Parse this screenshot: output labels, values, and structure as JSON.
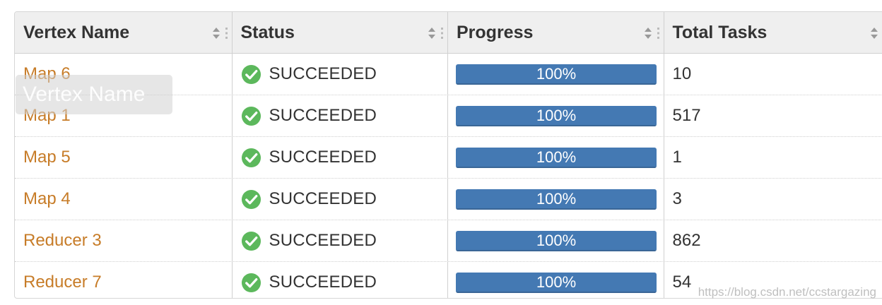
{
  "table": {
    "columns": [
      {
        "label": "Vertex Name"
      },
      {
        "label": "Status"
      },
      {
        "label": "Progress"
      },
      {
        "label": "Total Tasks"
      }
    ],
    "rows": [
      {
        "vertex": "Map 6",
        "status": "SUCCEEDED",
        "progress_text": "100%",
        "progress": 1.0,
        "total_tasks": "10"
      },
      {
        "vertex": "Map 1",
        "status": "SUCCEEDED",
        "progress_text": "100%",
        "progress": 1.0,
        "total_tasks": "517"
      },
      {
        "vertex": "Map 5",
        "status": "SUCCEEDED",
        "progress_text": "100%",
        "progress": 1.0,
        "total_tasks": "1"
      },
      {
        "vertex": "Map 4",
        "status": "SUCCEEDED",
        "progress_text": "100%",
        "progress": 1.0,
        "total_tasks": "3"
      },
      {
        "vertex": "Reducer 3",
        "status": "SUCCEEDED",
        "progress_text": "100%",
        "progress": 1.0,
        "total_tasks": "862"
      },
      {
        "vertex": "Reducer 7",
        "status": "SUCCEEDED",
        "progress_text": "100%",
        "progress": 1.0,
        "total_tasks": "54"
      }
    ]
  },
  "tooltip": {
    "text": "Vertex Name"
  },
  "watermark": {
    "text": "https://blog.csdn.net/ccstargazing"
  },
  "colors": {
    "link": "#c77c28",
    "success": "#5cb85c",
    "progress_fill": "#4479b3",
    "header_bg": "#efefef"
  },
  "icons": {
    "sort": "sort-icon",
    "status": "check-circle-icon",
    "grip": "column-grip-icon"
  }
}
